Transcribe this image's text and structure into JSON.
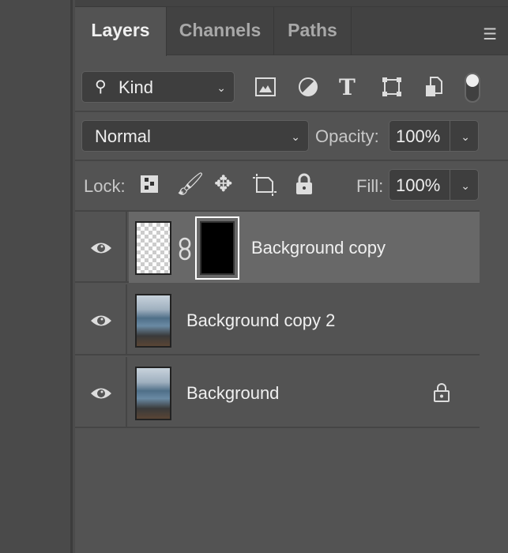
{
  "tabs": [
    {
      "label": "Layers",
      "active": true
    },
    {
      "label": "Channels",
      "active": false
    },
    {
      "label": "Paths",
      "active": false
    }
  ],
  "filter": {
    "kind_label": "Kind",
    "icons": [
      "image-filter-icon",
      "adjustment-filter-icon",
      "type-filter-icon",
      "shape-filter-icon",
      "smart-object-filter-icon"
    ],
    "toggle": "on"
  },
  "blend": {
    "mode": "Normal",
    "opacity_label": "Opacity:",
    "opacity": "100%"
  },
  "lock": {
    "label": "Lock:",
    "fill_label": "Fill:",
    "fill": "100%"
  },
  "layers": [
    {
      "name": "Background copy",
      "selected": true,
      "has_mask": true,
      "visible": true,
      "locked": false
    },
    {
      "name": "Background copy 2",
      "selected": false,
      "has_mask": false,
      "visible": true,
      "locked": false
    },
    {
      "name": "Background",
      "selected": false,
      "has_mask": false,
      "visible": true,
      "locked": true
    }
  ],
  "colors": {
    "panel": "#535353",
    "selected_row": "#686868",
    "tab_inactive": "#424242"
  }
}
